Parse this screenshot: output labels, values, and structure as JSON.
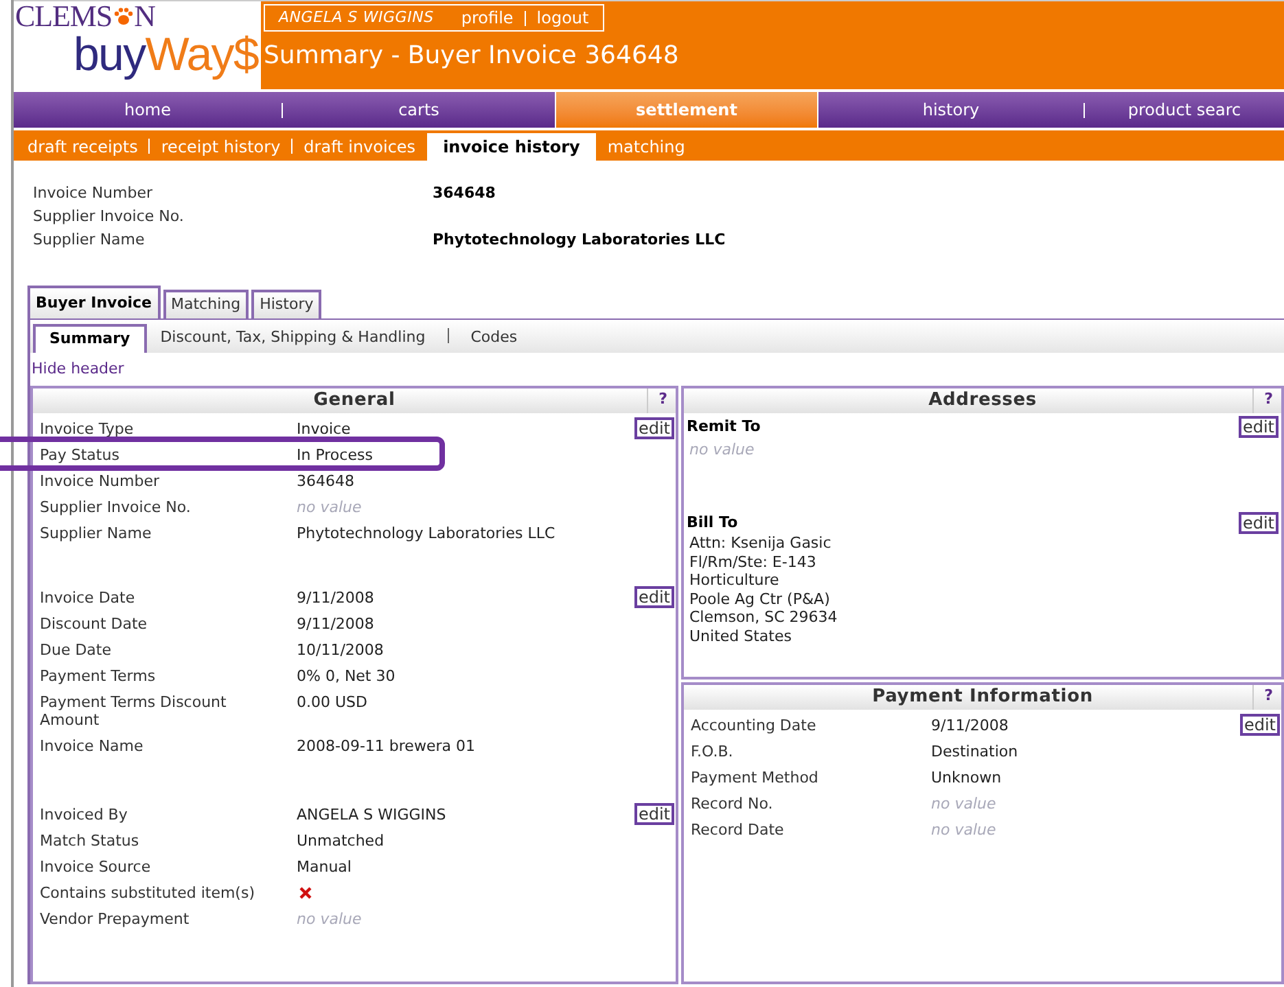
{
  "logo": {
    "line1_before": "CLEMS",
    "line1_after": "N",
    "line2": "buy",
    "line2_accent": "Way$"
  },
  "user_bar": {
    "user": "ANGELA S WIGGINS",
    "links": [
      "profile",
      "logout"
    ]
  },
  "page_title": "Summary - Buyer Invoice 364648",
  "main_nav": [
    {
      "label": "home",
      "selected": false
    },
    {
      "label": "carts",
      "selected": false
    },
    {
      "label": "settlement",
      "selected": true
    },
    {
      "label": "history",
      "selected": false
    },
    {
      "label": "product searc",
      "selected": false
    }
  ],
  "sub_nav": [
    {
      "label": "draft receipts",
      "selected": false
    },
    {
      "label": "receipt history",
      "selected": false
    },
    {
      "label": "draft invoices",
      "selected": false
    },
    {
      "label": "invoice history",
      "selected": true
    },
    {
      "label": "matching",
      "selected": false
    }
  ],
  "header_fields": [
    {
      "label": "Invoice Number",
      "value": "364648"
    },
    {
      "label": "Supplier Invoice No."
    },
    {
      "label": "Supplier Name",
      "value": "Phytotechnology Laboratories LLC"
    }
  ],
  "tabs": [
    {
      "label": "Buyer Invoice",
      "selected": true
    },
    {
      "label": "Matching",
      "selected": false
    },
    {
      "label": "History",
      "selected": false
    }
  ],
  "sub_tabs": [
    {
      "label": "Summary",
      "selected": true
    },
    {
      "label": "Discount, Tax, Shipping & Handling",
      "selected": false
    },
    {
      "label": "Codes",
      "selected": false
    }
  ],
  "hide_header": "Hide header",
  "general": {
    "title": "General",
    "help": "?",
    "groups": [
      {
        "edit": "edit",
        "rows": [
          {
            "label": "Invoice Type",
            "kind": "text",
            "value": "Invoice"
          },
          {
            "label": "Pay Status",
            "kind": "text",
            "value": "In Process"
          },
          {
            "label": "Invoice Number",
            "kind": "text",
            "value": "364648"
          },
          {
            "label": "Supplier Invoice No.",
            "kind": "empty",
            "value": "no value"
          },
          {
            "label": "Supplier Name",
            "kind": "text",
            "value": "Phytotechnology Laboratories LLC"
          }
        ]
      },
      {
        "edit": "edit",
        "rows": [
          {
            "label": "Invoice Date",
            "kind": "text",
            "value": "9/11/2008"
          },
          {
            "label": "Discount Date",
            "kind": "text",
            "value": "9/11/2008"
          },
          {
            "label": "Due Date",
            "kind": "text",
            "value": "10/11/2008"
          },
          {
            "label": "Payment Terms",
            "kind": "text",
            "value": "0% 0, Net 30"
          },
          {
            "label": "Payment Terms Discount Amount",
            "kind": "text",
            "value": "0.00 USD"
          },
          {
            "label": "Invoice Name",
            "kind": "text",
            "value": "2008-09-11 brewera 01"
          }
        ]
      },
      {
        "edit": "edit",
        "rows": [
          {
            "label": "Invoiced By",
            "kind": "text",
            "value": "ANGELA S WIGGINS"
          },
          {
            "label": "Match Status",
            "kind": "text",
            "value": "Unmatched"
          },
          {
            "label": "Invoice Source",
            "kind": "text",
            "value": "Manual"
          },
          {
            "label": "Contains substituted item(s)",
            "kind": "cross"
          },
          {
            "label": "Vendor Prepayment",
            "kind": "empty",
            "value": "no value"
          }
        ]
      }
    ]
  },
  "addresses": {
    "title": "Addresses",
    "help": "?",
    "blocks": [
      {
        "heading": "Remit To",
        "edit": "edit",
        "empty": "no value"
      },
      {
        "heading": "Bill To",
        "edit": "edit",
        "lines": [
          "Attn: Ksenija Gasic",
          "Fl/Rm/Ste: E-143",
          "Horticulture",
          "Poole Ag Ctr (P&A)",
          "Clemson, SC 29634",
          "United States"
        ]
      }
    ]
  },
  "payment_information": {
    "title": "Payment Information",
    "help": "?",
    "edit": "edit",
    "rows": [
      {
        "label": "Accounting Date",
        "kind": "text",
        "value": "9/11/2008"
      },
      {
        "label": "F.O.B.",
        "kind": "text",
        "value": "Destination"
      },
      {
        "label": "Payment Method",
        "kind": "text",
        "value": "Unknown"
      },
      {
        "label": "Record No.",
        "kind": "empty",
        "value": "no value"
      },
      {
        "label": "Record Date",
        "kind": "empty",
        "value": "no value"
      }
    ]
  }
}
